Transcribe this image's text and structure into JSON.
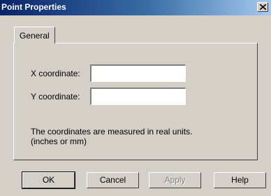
{
  "window": {
    "title": "Point Properties",
    "close_glyph": "close-icon"
  },
  "tabs": [
    {
      "label": "General",
      "selected": true
    }
  ],
  "form": {
    "x_label": "X coordinate:",
    "x_value": "",
    "y_label": "Y coordinate:",
    "y_value": "",
    "note_line1": "The coordinates are measured in real units.",
    "note_line2": "(inches or mm)"
  },
  "buttons": {
    "ok": "OK",
    "cancel": "Cancel",
    "apply": "Apply",
    "help": "Help"
  }
}
